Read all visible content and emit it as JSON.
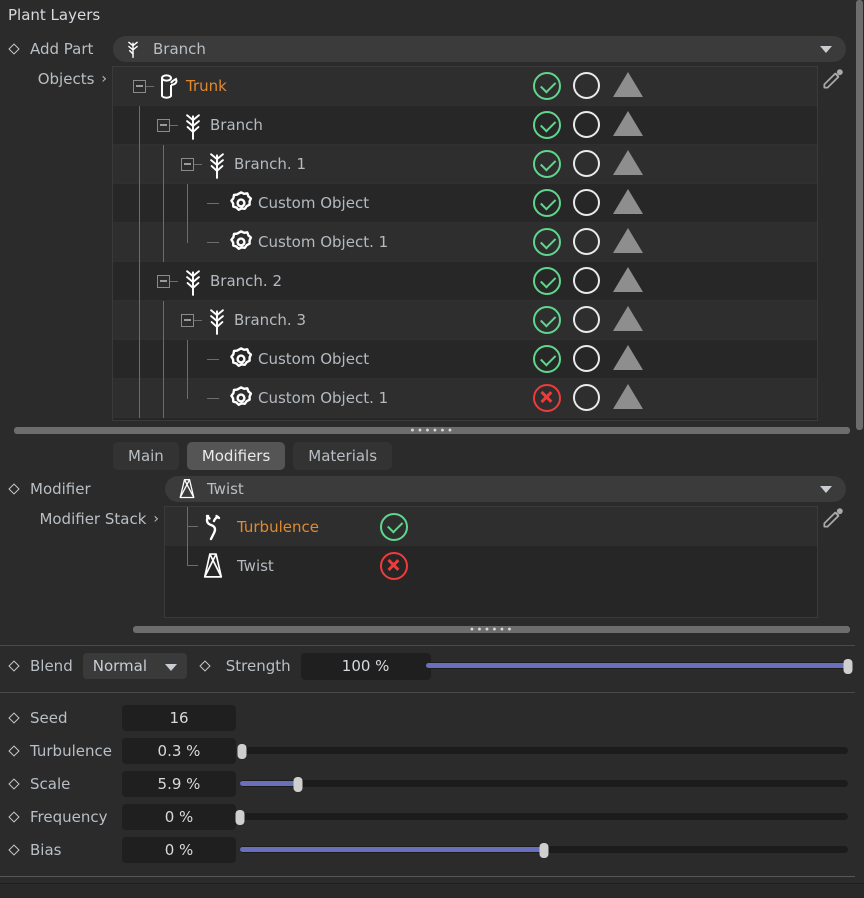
{
  "title": "Plant Layers",
  "add_part": {
    "label": "Add Part",
    "diamond_icon": "keyframe-diamond-icon",
    "combo_value": "Branch",
    "combo_icon": "branch-icon",
    "caret_icon": "chevron-down-icon"
  },
  "objects": {
    "label": "Objects",
    "chevron": "›",
    "eyedropper_icon": "eyedropper-icon"
  },
  "tree": {
    "columns": [
      "enabled",
      "select",
      "visibility"
    ],
    "rows": [
      {
        "name": "Trunk",
        "icon": "trunk-icon",
        "depth": 0,
        "expander": "collapse",
        "selected": true,
        "check": "enabled-green",
        "circle": "circle-outline",
        "triangle": "triangle-gray"
      },
      {
        "name": "Branch",
        "icon": "branch-icon",
        "depth": 1,
        "expander": "collapse",
        "selected": false,
        "check": "enabled-green",
        "circle": "circle-outline",
        "triangle": "triangle-gray"
      },
      {
        "name": "Branch. 1",
        "icon": "branch-icon",
        "depth": 2,
        "expander": "collapse",
        "selected": false,
        "check": "enabled-green",
        "circle": "circle-outline",
        "triangle": "triangle-gray"
      },
      {
        "name": "Custom Object",
        "icon": "custom-object-icon",
        "depth": 3,
        "expander": "none",
        "selected": false,
        "check": "enabled-green",
        "circle": "circle-outline",
        "triangle": "triangle-gray"
      },
      {
        "name": "Custom Object. 1",
        "icon": "custom-object-icon",
        "depth": 3,
        "expander": "none",
        "selected": false,
        "check": "enabled-green",
        "circle": "circle-outline",
        "triangle": "triangle-gray"
      },
      {
        "name": "Branch. 2",
        "icon": "branch-icon",
        "depth": 1,
        "expander": "collapse",
        "selected": false,
        "check": "enabled-green",
        "circle": "circle-outline",
        "triangle": "triangle-gray"
      },
      {
        "name": "Branch. 3",
        "icon": "branch-icon",
        "depth": 2,
        "expander": "collapse",
        "selected": false,
        "check": "enabled-green",
        "circle": "circle-outline",
        "triangle": "triangle-gray"
      },
      {
        "name": "Custom Object",
        "icon": "custom-object-icon",
        "depth": 3,
        "expander": "none",
        "selected": false,
        "check": "enabled-green",
        "circle": "circle-outline",
        "triangle": "triangle-gray"
      },
      {
        "name": "Custom Object. 1",
        "icon": "custom-object-icon",
        "depth": 3,
        "expander": "none",
        "selected": false,
        "check": "disabled-red",
        "circle": "circle-outline",
        "triangle": "triangle-gray"
      }
    ]
  },
  "tabs": [
    {
      "label": "Main",
      "active": false
    },
    {
      "label": "Modifiers",
      "active": true
    },
    {
      "label": "Materials",
      "active": false
    }
  ],
  "modifier": {
    "label": "Modifier",
    "combo_value": "Twist",
    "combo_icon": "twist-icon",
    "stack_label": "Modifier Stack",
    "stack_chevron": "›",
    "eyedropper_icon": "eyedropper-icon",
    "stack": [
      {
        "name": "Turbulence",
        "icon": "turbulence-icon",
        "selected": true,
        "status": "enabled-green"
      },
      {
        "name": "Twist",
        "icon": "twist-icon",
        "selected": false,
        "status": "disabled-red"
      }
    ]
  },
  "blend": {
    "label": "Blend",
    "mode": "Normal",
    "caret_icon": "chevron-down-icon",
    "strength_label": "Strength",
    "strength_value": "100 %",
    "strength_percent": 100
  },
  "parameters": [
    {
      "label": "Seed",
      "value": "16",
      "has_slider": false,
      "percent": 0
    },
    {
      "label": "Turbulence",
      "value": "0.3 %",
      "has_slider": true,
      "percent": 0.3
    },
    {
      "label": "Scale",
      "value": "5.9 %",
      "has_slider": true,
      "percent": 9.5
    },
    {
      "label": "Frequency",
      "value": "0 %",
      "has_slider": true,
      "percent": 0
    },
    {
      "label": "Bias",
      "value": "0 %",
      "has_slider": true,
      "percent": 50
    }
  ],
  "colors": {
    "background": "#2b2b2b",
    "panel": "#262626",
    "row_alt": "#2e2e2e",
    "accent_selected": "#e08a30",
    "text": "#b9bfc4",
    "enabled_green": "#5fd68c",
    "disabled_red": "#ef3b3b",
    "slider_fill": "#6a6fbb",
    "tab_active": "#555555"
  }
}
